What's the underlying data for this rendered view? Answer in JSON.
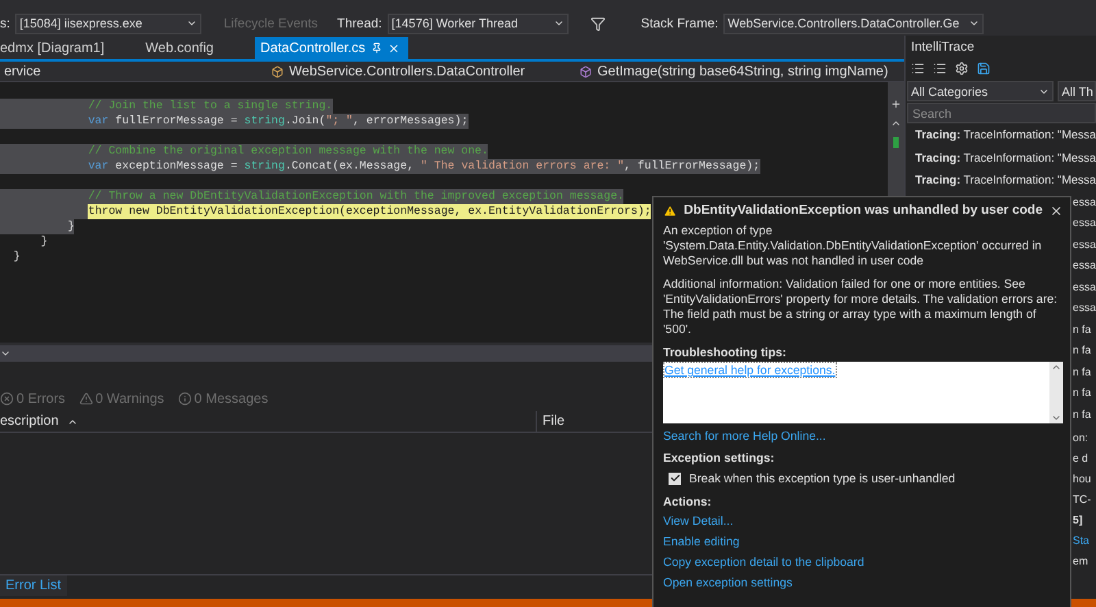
{
  "debug_toolbar": {
    "process_label": "s:",
    "process": "[15084] iisexpress.exe",
    "lifecycle": "Lifecycle Events",
    "thread_label": "Thread:",
    "thread": "[14576] Worker Thread",
    "stack_frame_label": "Stack Frame:",
    "stack_frame": "WebService.Controllers.DataController.Ge"
  },
  "tabs": [
    {
      "label": "edmx [Diagram1]",
      "selected": false
    },
    {
      "label": "Web.config",
      "selected": false
    },
    {
      "label": "DataController.cs",
      "selected": true
    }
  ],
  "navigation": {
    "project": "ervice",
    "class": "WebService.Controllers.DataController",
    "member": "GetImage(string base64String, string imgName)"
  },
  "code_lines": [
    {
      "kind": "code",
      "selected": true,
      "tokens": [
        {
          "kind": "comment",
          "text": "             // Join the list to a single string."
        }
      ]
    },
    {
      "kind": "code",
      "selected": true,
      "tokens": [
        {
          "kind": "keyword",
          "text": "             var"
        },
        {
          "kind": "plain",
          "text": " fullErrorMessage = "
        },
        {
          "kind": "type",
          "text": "string"
        },
        {
          "kind": "plain",
          "text": ".Join("
        },
        {
          "kind": "string",
          "text": "\"; \""
        },
        {
          "kind": "plain",
          "text": ", errorMessages);"
        }
      ]
    },
    {
      "kind": "blank"
    },
    {
      "kind": "code",
      "selected": true,
      "tokens": [
        {
          "kind": "comment",
          "text": "             // Combine the original exception message with the new one."
        }
      ]
    },
    {
      "kind": "code",
      "selected": true,
      "tokens": [
        {
          "kind": "keyword",
          "text": "             var"
        },
        {
          "kind": "plain",
          "text": " exceptionMessage = "
        },
        {
          "kind": "type",
          "text": "string"
        },
        {
          "kind": "plain",
          "text": ".Concat(ex.Message, "
        },
        {
          "kind": "string",
          "text": "\" The validation errors are: \""
        },
        {
          "kind": "plain",
          "text": ", fullErrorMessage);"
        }
      ]
    },
    {
      "kind": "blank"
    },
    {
      "kind": "code",
      "selected": true,
      "tokens": [
        {
          "kind": "comment",
          "text": "             // Throw a new DbEntityValidationException with the improved exception message."
        }
      ]
    },
    {
      "kind": "code",
      "selected": true,
      "tokens": [
        {
          "kind": "current",
          "text": "             throw new DbEntityValidationException(exceptionMessage, ex.EntityValidationErrors);"
        }
      ]
    },
    {
      "kind": "code",
      "selected": true,
      "tokens": [
        {
          "kind": "plain",
          "text": "          }"
        }
      ]
    },
    {
      "kind": "code",
      "selected": false,
      "tokens": [
        {
          "kind": "plain",
          "text": "      }"
        }
      ]
    },
    {
      "kind": "code",
      "selected": false,
      "tokens": [
        {
          "kind": "plain",
          "text": "  }"
        }
      ]
    }
  ],
  "intellitrace": {
    "title": "IntelliTrace",
    "category": "All Categories",
    "thread_filter": "All Th",
    "search_placeholder": "Search",
    "events": [
      {
        "category": "Tracing:",
        "text": "TraceInformation: \"Messa"
      },
      {
        "category": "Tracing:",
        "text": "TraceInformation: \"Messa"
      },
      {
        "category": "Tracing:",
        "text": "TraceInformation: \"Messa"
      }
    ],
    "cut_rows": [
      {
        "kind": "row",
        "text": "essa"
      },
      {
        "kind": "row",
        "text": "essa"
      },
      {
        "kind": "row",
        "text": "essa"
      },
      {
        "kind": "row",
        "text": "essa"
      },
      {
        "kind": "row",
        "text": "essa"
      },
      {
        "kind": "row",
        "text": "essa"
      },
      {
        "kind": "row",
        "text": "n fa"
      },
      {
        "kind": "row",
        "text": "n fa"
      },
      {
        "kind": "row",
        "text": "n fa"
      },
      {
        "kind": "row",
        "text": "n fa"
      },
      {
        "kind": "row",
        "text": "n fa"
      },
      {
        "kind": "line",
        "text": "on:"
      },
      {
        "kind": "line",
        "text": "e d"
      },
      {
        "kind": "line",
        "text": "hou"
      },
      {
        "kind": "line",
        "text": "TC-"
      },
      {
        "kind": "bold",
        "text": "5]"
      },
      {
        "kind": "link",
        "text": "Sta"
      },
      {
        "kind": "line",
        "text": "em"
      }
    ]
  },
  "error_list": {
    "filters": [
      {
        "kind": "error",
        "label": "0 Errors"
      },
      {
        "kind": "warning",
        "label": "0 Warnings"
      },
      {
        "kind": "message",
        "label": "0 Messages"
      }
    ],
    "columns": [
      "escription",
      "File"
    ],
    "tab": "Error List"
  },
  "exception_popup": {
    "title": "DbEntityValidationException was unhandled by user code",
    "paragraphs": [
      "An exception of type 'System.Data.Entity.Validation.DbEntityValidationException' occurred in WebService.dll but was not handled in user code",
      "Additional information: Validation failed for one or more entities. See 'EntityValidationErrors' property for more details. The validation errors are: The field path must be a string or array type with a maximum length of '500'."
    ],
    "tips_heading": "Troubleshooting tips:",
    "tips": [
      "Get general help for exceptions."
    ],
    "help_link": "Search for more Help Online...",
    "settings_heading": "Exception settings:",
    "break_option": {
      "label": "Break when this exception type is user-unhandled",
      "checked": true
    },
    "actions_heading": "Actions:",
    "actions": [
      "View Detail...",
      "Enable editing",
      "Copy exception detail to the clipboard",
      "Open exception settings"
    ]
  }
}
